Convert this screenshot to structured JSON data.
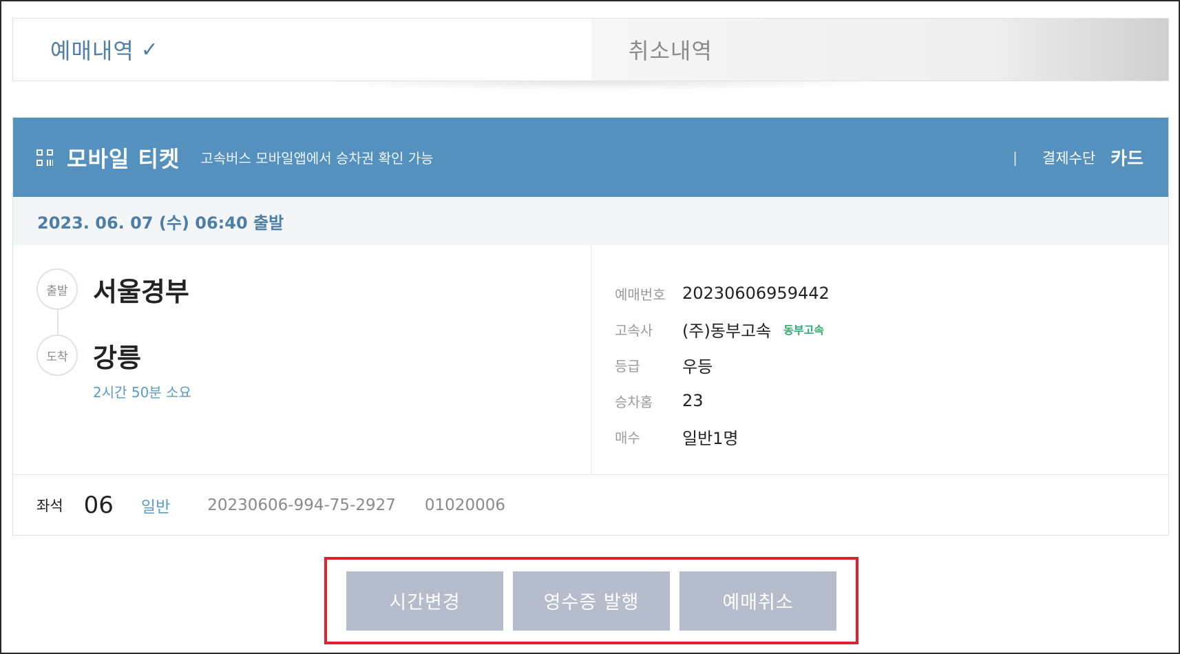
{
  "tabs": {
    "active": "예매내역",
    "active_check": "✓",
    "inactive": "취소내역"
  },
  "ticket": {
    "header": {
      "title": "모바일 티켓",
      "subtitle": "고속버스 모바일앱에서 승차권 확인 가능",
      "separator": "|",
      "payment_label": "결제수단",
      "payment_value": "카드"
    },
    "departure_datetime": "2023. 06. 07 (수) 06:40 출발",
    "route": {
      "departure_tag": "출발",
      "departure_name": "서울경부",
      "arrival_tag": "도착",
      "arrival_name": "강릉",
      "duration": "2시간 50분 소요"
    },
    "info": {
      "reservation_label": "예매번호",
      "reservation_value": "20230606959442",
      "company_label": "고속사",
      "company_value": "(주)동부고속",
      "company_logo_text": "동부고속",
      "grade_label": "등급",
      "grade_value": "우등",
      "platform_label": "승차홈",
      "platform_value": "23",
      "count_label": "매수",
      "count_value": "일반1명"
    },
    "seat": {
      "label": "좌석",
      "number": "06",
      "type": "일반",
      "code1": "20230606-994-75-2927",
      "code2": "01020006"
    }
  },
  "actions": {
    "change_time": "시간변경",
    "receipt": "영수증 발행",
    "cancel": "예매취소"
  },
  "colors": {
    "header_blue": "#5591bf",
    "accent_text": "#4f7fa6",
    "button_gray": "#b5bccb",
    "highlight_red": "#e0202c"
  }
}
